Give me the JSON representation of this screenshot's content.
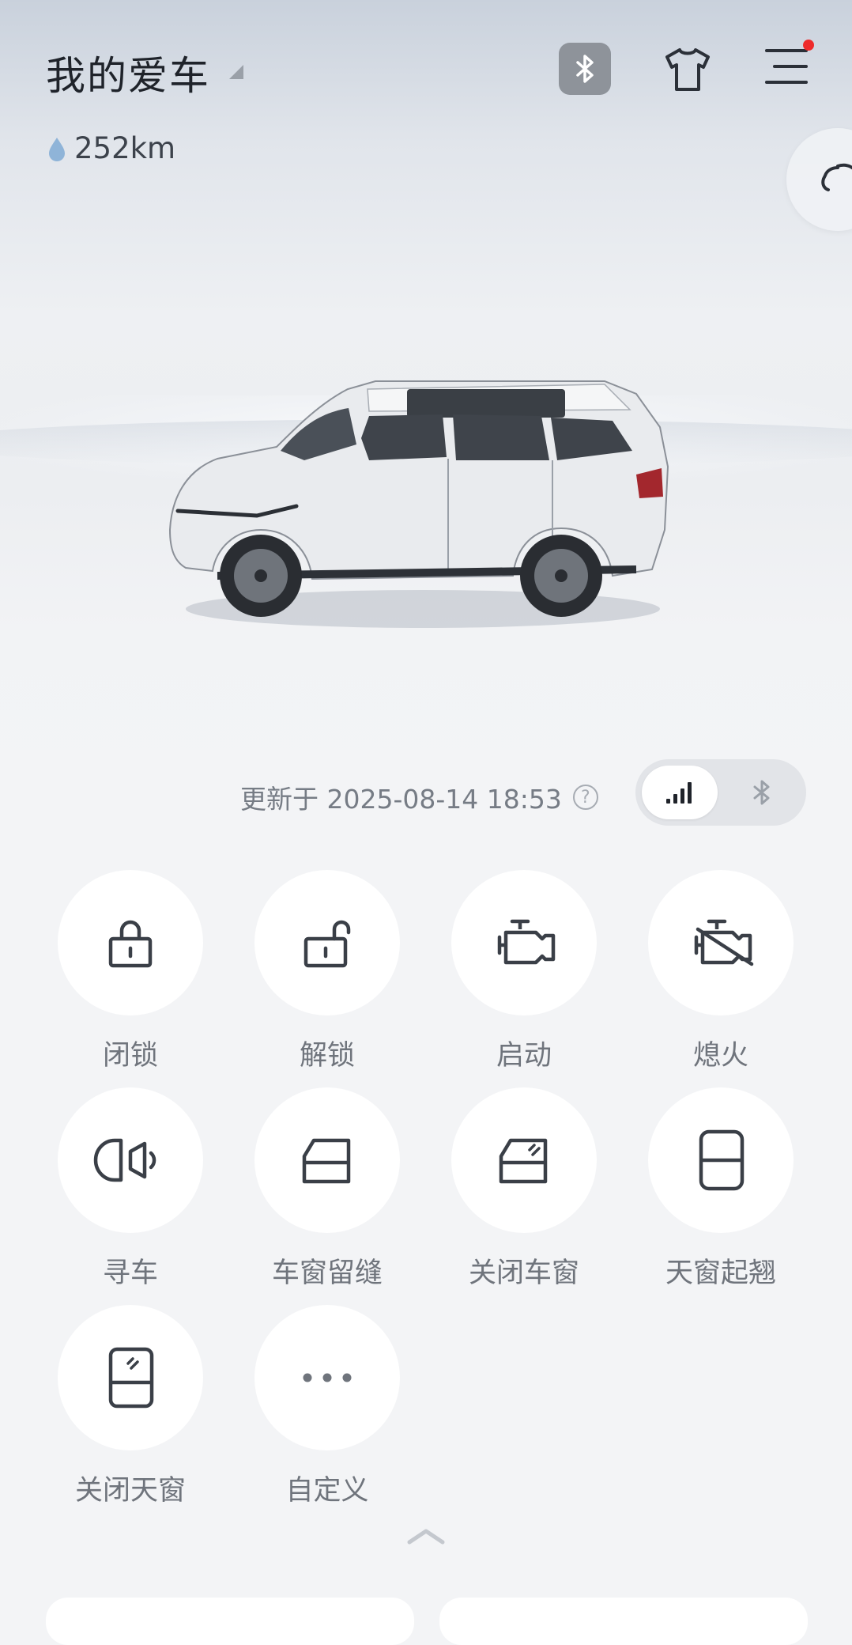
{
  "header": {
    "title": "我的爱车",
    "range": "252km"
  },
  "status": {
    "updated": "更新于 2025-08-14 18:53",
    "help": "?"
  },
  "actions": [
    {
      "label": "闭锁",
      "icon": "lock-icon"
    },
    {
      "label": "解锁",
      "icon": "unlock-icon"
    },
    {
      "label": "启动",
      "icon": "engine-start-icon"
    },
    {
      "label": "熄火",
      "icon": "engine-off-icon"
    },
    {
      "label": "寻车",
      "icon": "find-car-horn-icon"
    },
    {
      "label": "车窗留缝",
      "icon": "window-vent-icon"
    },
    {
      "label": "关闭车窗",
      "icon": "window-close-icon"
    },
    {
      "label": "天窗起翘",
      "icon": "sunroof-tilt-icon"
    },
    {
      "label": "关闭天窗",
      "icon": "sunroof-close-icon"
    },
    {
      "label": "自定义",
      "icon": "more-dots-icon"
    }
  ],
  "colors": {
    "icon": "#3a3f47",
    "label": "#6f747c",
    "notification": "#ee2b2b"
  }
}
